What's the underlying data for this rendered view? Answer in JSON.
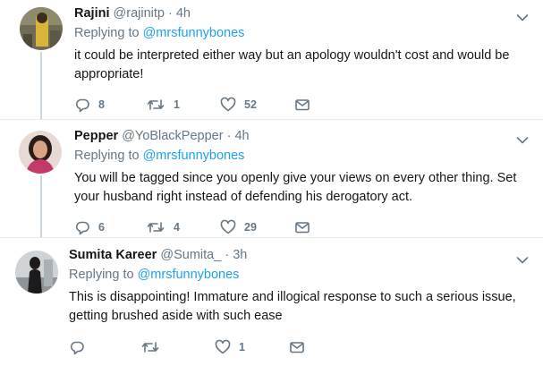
{
  "tweets": [
    {
      "name": "Rajini",
      "handle": "@rajinitp",
      "separator": "·",
      "time": "4h",
      "replying_prefix": "Replying to",
      "replying_to": "@mrsfunnybones",
      "text": "it could be interpreted either way but an apology wouldn't cost and would be appropriate!",
      "reply_count": "8",
      "retweet_count": "1",
      "like_count": "52"
    },
    {
      "name": "Pepper",
      "handle": "@YoBlackPepper",
      "separator": "·",
      "time": "4h",
      "replying_prefix": "Replying to",
      "replying_to": "@mrsfunnybones",
      "text": "You will be tagged since you openly give your views on every other thing. Set your husband right instead of defending his derogatory act.",
      "reply_count": "6",
      "retweet_count": "4",
      "like_count": "29"
    },
    {
      "name": "Sumita Kareer",
      "handle": "@Sumita_",
      "separator": "·",
      "time": "3h",
      "replying_prefix": "Replying to",
      "replying_to": "@mrsfunnybones",
      "text": "This is disappointing! Immature and illogical response to such a serious issue, getting brushed aside with such ease",
      "reply_count": "",
      "retweet_count": "",
      "like_count": "1"
    }
  ],
  "icons": {
    "reply": "reply-icon",
    "retweet": "retweet-icon",
    "like": "heart-icon",
    "dm": "envelope-icon",
    "more": "chevron-down-icon"
  },
  "colors": {
    "link": "#1da1f2",
    "muted": "#657786",
    "text": "#14171a",
    "divider": "#e6ecf0",
    "thread": "#ccd6dd"
  }
}
